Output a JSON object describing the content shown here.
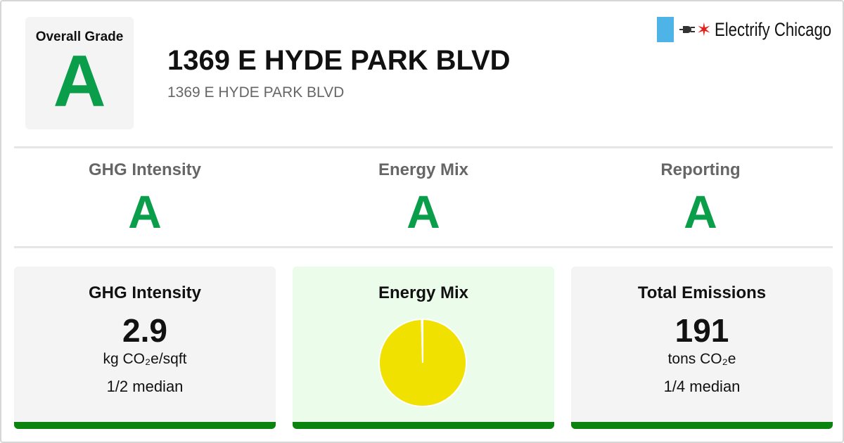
{
  "overall": {
    "label": "Overall Grade",
    "grade": "A"
  },
  "building": {
    "title": "1369 E HYDE PARK BLVD",
    "address": "1369 E HYDE PARK BLVD"
  },
  "brand": {
    "name": "Electrify Chicago",
    "flag_color": "#4eb3e6",
    "star_color": "#e3201b",
    "star": "✶"
  },
  "grades": [
    {
      "name": "GHG Intensity",
      "grade": "A"
    },
    {
      "name": "Energy Mix",
      "grade": "A"
    },
    {
      "name": "Reporting",
      "grade": "A"
    }
  ],
  "cards": {
    "ghg": {
      "title": "GHG Intensity",
      "value": "2.9",
      "unit": "kg CO₂e/sqft",
      "median": "1/2 median"
    },
    "mix": {
      "title": "Energy Mix"
    },
    "emissions": {
      "title": "Total Emissions",
      "value": "191",
      "unit": "tons CO₂e",
      "median": "1/4 median"
    }
  },
  "chart_data": {
    "type": "pie",
    "slices": [
      {
        "label": "",
        "value": 99.6,
        "color": "#f0e100"
      },
      {
        "label": "",
        "value": 0.4,
        "color": "#f7f7f7"
      }
    ]
  },
  "colors": {
    "grade_green": "#0a9e4a",
    "bar_green": "#0a840f"
  }
}
